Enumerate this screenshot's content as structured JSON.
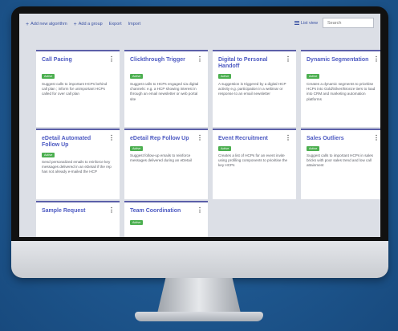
{
  "toolbar": {
    "add_algorithm": "Add new algorithm",
    "add_group": "Add a group",
    "export": "Export",
    "import": "Import",
    "list_view": "List view",
    "search_placeholder": "Search"
  },
  "cards": [
    {
      "title": "Call Pacing",
      "badge": "Active",
      "description": "Suggest calls to important HCPs behind call plan ; inform for unimportant HCPs called for over call plan"
    },
    {
      "title": "Clickthrough Trigger",
      "badge": "Active",
      "description": "Suggest calls to HCPs engaged via digital channels: e.g. a HCP showing interest in through an email newsletter or web portal site"
    },
    {
      "title": "Digital to Personal Handoff",
      "badge": "Active",
      "description": "A suggestion is triggered by a digital HCP activity e.g. participation in a webinar or response to an email newsletter"
    },
    {
      "title": "Dynamic Segmentation",
      "badge": "Active",
      "description": "Creates a dynamic segments to prioritise HCPs into Gold/Silver/Bronze tiers to load into CRM and marketing automation platforms"
    },
    {
      "title": "eDetail Automated Follow Up",
      "badge": "Active",
      "description": "Send personalized emails to reinforce key messages delivered in an eDetail if the rep has not already e-mailed the HCP"
    },
    {
      "title": "eDetail Rep Follow Up",
      "badge": "Active",
      "description": "Suggest follow-up emails to reinforce messages delivered during an eDetail"
    },
    {
      "title": "Event Recruitment",
      "badge": "Active",
      "description": "Creates a list of HCPs for an event invite using profiling components to prioritise the key HCPs"
    },
    {
      "title": "Sales Outliers",
      "badge": "Active",
      "description": "Suggest calls to important HCPs in sales bricks with poor sales trend and low call attainment"
    },
    {
      "title": "Sample Request",
      "badge": "",
      "description": ""
    },
    {
      "title": "Team Coordination",
      "badge": "Active",
      "description": ""
    }
  ]
}
